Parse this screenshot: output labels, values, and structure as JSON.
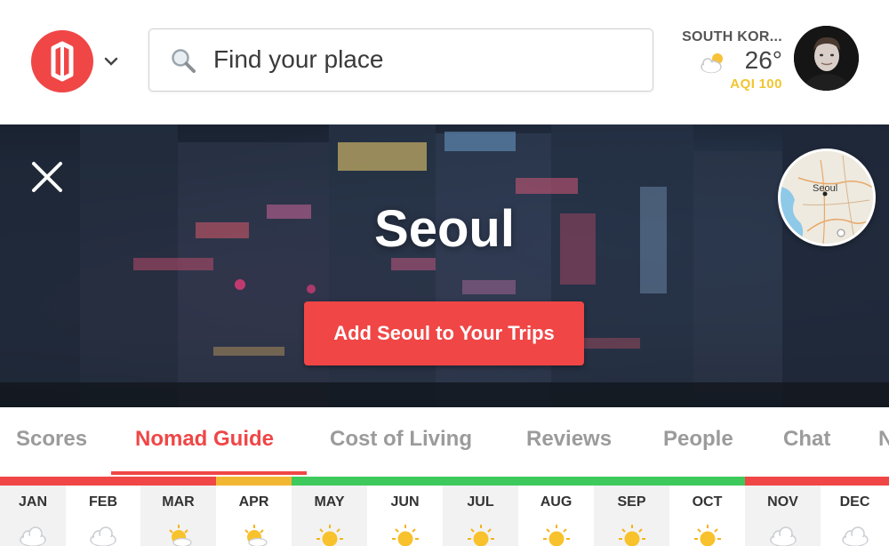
{
  "header": {
    "search_placeholder": "Find your place",
    "location_country": "SOUTH KOR...",
    "temperature": "26°",
    "aqi_label": "AQI",
    "aqi_value": "100",
    "icons": [
      "logo-icon",
      "chevron-down-icon",
      "search-icon",
      "partly-cloudy-icon",
      "avatar"
    ]
  },
  "hero": {
    "city": "Seoul",
    "cta_label": "Add Seoul to Your Trips",
    "map_label": "Seoul",
    "icons": [
      "close-icon",
      "map-thumbnail"
    ]
  },
  "tabs": [
    {
      "label": "Scores",
      "active": false
    },
    {
      "label": "Nomad Guide",
      "active": true
    },
    {
      "label": "Cost of Living",
      "active": false
    },
    {
      "label": "Reviews",
      "active": false
    },
    {
      "label": "People",
      "active": false
    },
    {
      "label": "Chat",
      "active": false
    },
    {
      "label": "N",
      "active": false
    }
  ],
  "months": [
    {
      "label": "JAN",
      "weather": "cloudy-icon",
      "color": "#f04646"
    },
    {
      "label": "FEB",
      "weather": "cloudy-icon",
      "color": "#f04646"
    },
    {
      "label": "MAR",
      "weather": "partly-sunny-icon",
      "color": "#f04646"
    },
    {
      "label": "APR",
      "weather": "partly-sunny-icon",
      "color": "#f2b732"
    },
    {
      "label": "MAY",
      "weather": "sunny-icon",
      "color": "#3ec95c"
    },
    {
      "label": "JUN",
      "weather": "sunny-icon",
      "color": "#3ec95c"
    },
    {
      "label": "JUL",
      "weather": "sunny-icon",
      "color": "#3ec95c"
    },
    {
      "label": "AUG",
      "weather": "sunny-icon",
      "color": "#3ec95c"
    },
    {
      "label": "SEP",
      "weather": "sunny-icon",
      "color": "#3ec95c"
    },
    {
      "label": "OCT",
      "weather": "sunny-icon",
      "color": "#3ec95c"
    },
    {
      "label": "NOV",
      "weather": "cloudy-icon",
      "color": "#f04646"
    },
    {
      "label": "DEC",
      "weather": "cloudy-icon",
      "color": "#f04646"
    }
  ],
  "colors": {
    "accent": "#f04646",
    "aqi": "#f2c52f",
    "good": "#3ec95c",
    "ok": "#f2b732"
  }
}
